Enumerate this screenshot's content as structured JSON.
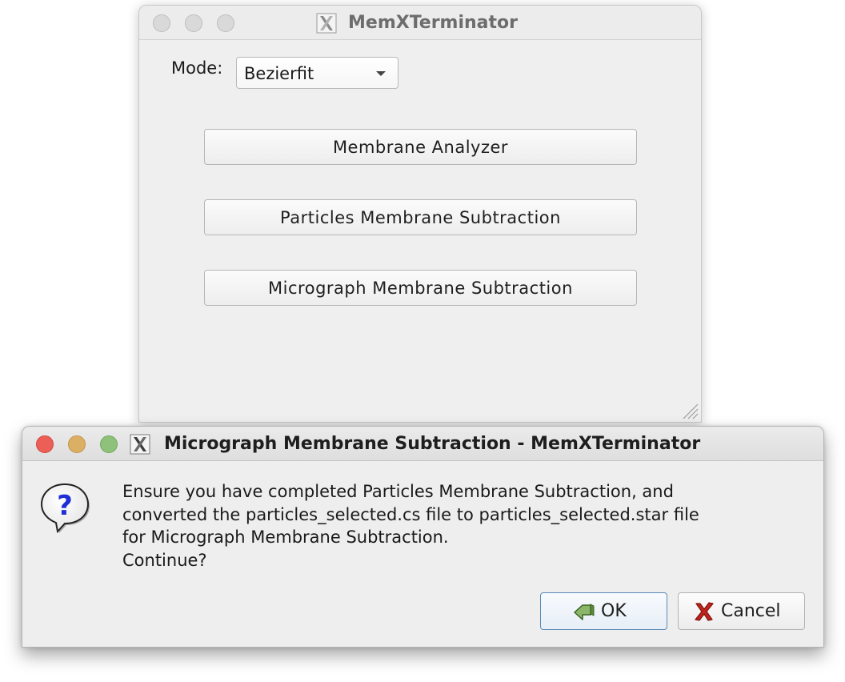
{
  "main_window": {
    "title": "MemXTerminator",
    "mode_label": "Mode:",
    "mode_value": "Bezierfit",
    "buttons": {
      "membrane_analyzer": "Membrane Analyzer",
      "particles_subtraction": "Particles Membrane Subtraction",
      "micrograph_subtraction": "Micrograph Membrane Subtraction"
    }
  },
  "dialog": {
    "title": "Micrograph Membrane Subtraction - MemXTerminator",
    "message_lines": [
      "Ensure you have completed Particles Membrane Subtraction, and",
      "converted the particles_selected.cs file to particles_selected.star file",
      "for Micrograph Membrane Subtraction.",
      "Continue?"
    ],
    "ok_label": "OK",
    "cancel_label": "Cancel",
    "icons": {
      "message": "question-icon",
      "ok": "ok-arrow-icon",
      "cancel": "red-x-icon"
    }
  },
  "colors": {
    "close": "#ec5f57",
    "minimize": "#dcb064",
    "zoom": "#8ec27a",
    "question_blue": "#1f2fd6",
    "ok_icon_green": "#5a8a3a",
    "cancel_red": "#c4231c"
  }
}
